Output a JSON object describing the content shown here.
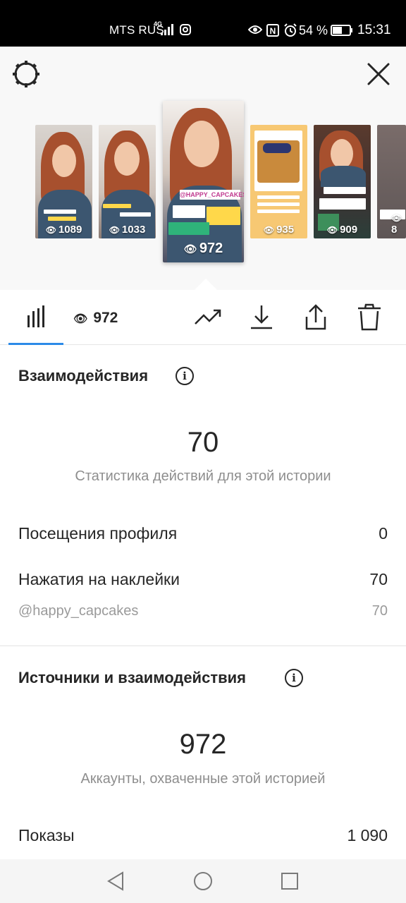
{
  "status_bar": {
    "carrier": "MTS RUS",
    "network": "4G",
    "battery_percent": "54 %",
    "time": "15:31"
  },
  "stories": [
    {
      "views": "1089",
      "selected": false
    },
    {
      "views": "1033",
      "selected": false
    },
    {
      "views": "972",
      "selected": true,
      "sticker": "@HAPPY_CAPCAKES"
    },
    {
      "views": "935",
      "selected": false,
      "sticker": "@HAPPY_CAPCAKES"
    },
    {
      "views": "909",
      "selected": false,
      "sticker": "@HAPPY_CAPCAKES"
    },
    {
      "views": "8",
      "selected": false
    }
  ],
  "toolbar": {
    "views_count": "972",
    "accent_color": "#2c8ae8"
  },
  "interactions": {
    "title": "Взаимодействия",
    "total": "70",
    "caption": "Статистика действий для этой истории",
    "rows": [
      {
        "label": "Посещения профиля",
        "value": "0"
      },
      {
        "label": "Нажатия на наклейки",
        "value": "70"
      }
    ],
    "sub_rows": [
      {
        "label": "@happy_capcakes",
        "value": "70"
      }
    ]
  },
  "sources": {
    "title": "Источники и взаимодействия",
    "total": "972",
    "caption": "Аккаунты, охваченные этой историей",
    "rows": [
      {
        "label": "Показы",
        "value": "1 090"
      }
    ]
  }
}
